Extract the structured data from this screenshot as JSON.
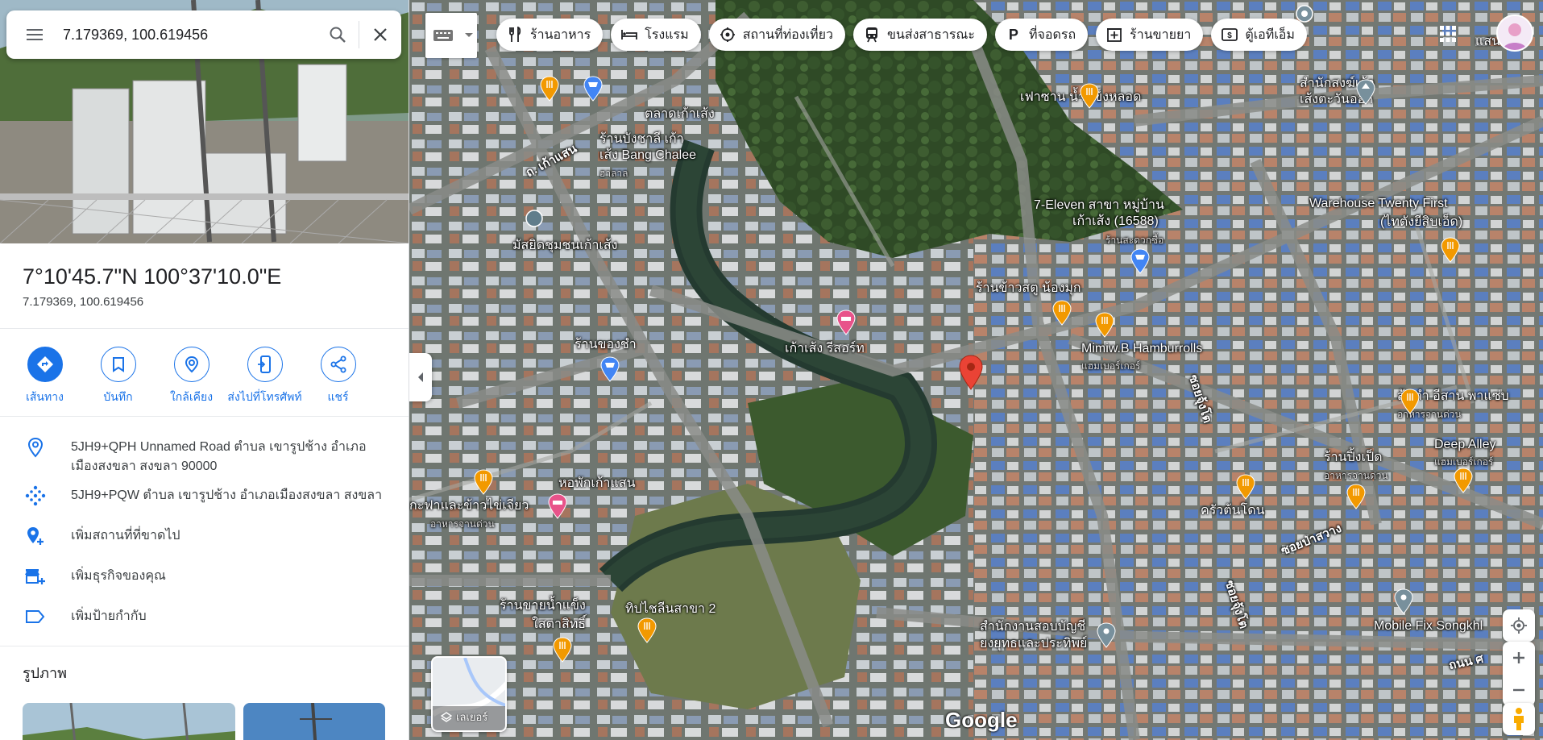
{
  "search": {
    "value": "7.179369, 100.619456"
  },
  "place": {
    "title": "7°10'45.7\"N 100°37'10.0\"E",
    "subtitle": "7.179369, 100.619456"
  },
  "actions": [
    {
      "label": "เส้นทาง"
    },
    {
      "label": "บันทึก"
    },
    {
      "label": "ใกล้เคียง"
    },
    {
      "label": "ส่งไปที่โทรศัพท์"
    },
    {
      "label": "แชร์"
    }
  ],
  "details": {
    "address": "5JH9+QPH Unnamed Road ตำบล เขารูปช้าง อำเภอเมืองสงขลา สงขลา 90000",
    "plus_code": "5JH9+PQW ตำบล เขารูปช้าง อำเภอเมืองสงขลา สงขลา",
    "add_missing": "เพิ่มสถานที่ที่ขาดไป",
    "add_business": "เพิ่มธุรกิจของคุณ",
    "add_label": "เพิ่มป้ายกำกับ"
  },
  "photos_heading": "รูปภาพ",
  "chips": [
    {
      "label": "ร้านอาหาร",
      "icon": "fork-knife-icon"
    },
    {
      "label": "โรงแรม",
      "icon": "bed-icon"
    },
    {
      "label": "สถานที่ท่องเที่ยว",
      "icon": "attraction-icon"
    },
    {
      "label": "ขนส่งสาธารณะ",
      "icon": "train-icon"
    },
    {
      "label": "ที่จอดรถ",
      "icon": "parking-icon"
    },
    {
      "label": "ร้านขายยา",
      "icon": "pharmacy-icon"
    },
    {
      "label": "ตู้เอทีเอ็ม",
      "icon": "atm-icon"
    }
  ],
  "map_labels": {
    "market": "ตลาดเก้าเส้ง",
    "bangchalee_1": "ร้านบังชาลี เก้า",
    "bangchalee_2": "เส้ง Bang Chalee",
    "bangchalee_sub": "ฮาลาล",
    "road_kaoseng": "ถ. เก้าแสน",
    "mosque": "มัสยิดชุมชนเก้าเส้ง",
    "shop_cha": "ร้านของชำ",
    "resort": "เก้าเส้ง รีสอร์ท",
    "khaowasatu": "ร้านข้าวสตู น้องมุก",
    "seven_1": "7-Eleven สาขา หมู่บ้าน",
    "seven_2": "เก้าเส้ง (16588)",
    "seven_sub": "ร้านสะดวกซื้อ",
    "ice": "เฟาซาน น้ำแข็งหลอด",
    "office_1": "สำนักสงฆ์เก้า",
    "office_2": "เส้งตะวันออก",
    "warehouse_1": "Warehouse Twenty First",
    "warehouse_2": "(ไทตังยีสิบเอ็ด)",
    "mimiw": "Mimiw.B Hamburrolls",
    "mimiw_sub": "แฮมเบอร์เกอร์",
    "somtam_1": "ส้มตำ อีสาน พาแซ่บ",
    "somtam_sub": "อาหารจานด่วน",
    "deep_alley": "Deep Alley",
    "deep_alley_sub": "แฮมเบอร์เกอร์",
    "ranpingped": "ร้านปิ้งเป็ด",
    "ranpingped_sub": "อาหารจานด่วน",
    "kruaton": "ครัวต้นโดน",
    "soi_1": "ซอยจุ้งโต",
    "soi_2": "ซอยป่าสวาง",
    "soi_3": "ซอยจุ้งโต",
    "dorm": "หอพักเก้าแสน",
    "kafae": "กะฟาและข้าวไข่เจียว",
    "kafae_sub": "อาหารจานด่วน",
    "icewater_1": "ร้านขายน้ำแข็ง",
    "icewater_2": "ใสตาสิทธิ์",
    "tipchai": "ทิปไชลีนสาขา 2",
    "audit_1": "สำนักงานสอบบัญชี",
    "audit_2": "ยงยุทธและประทิพย์",
    "mobilefix": "Mobile Fix Songkhl",
    "top_right": "แสน",
    "road_bottom": "ถนน ศ"
  },
  "layers_label": "เลเยอร์",
  "google_logo": "Google",
  "colors": {
    "accent": "#1a73e8",
    "pin_red": "#ea4335",
    "food_orange": "#f29900"
  }
}
